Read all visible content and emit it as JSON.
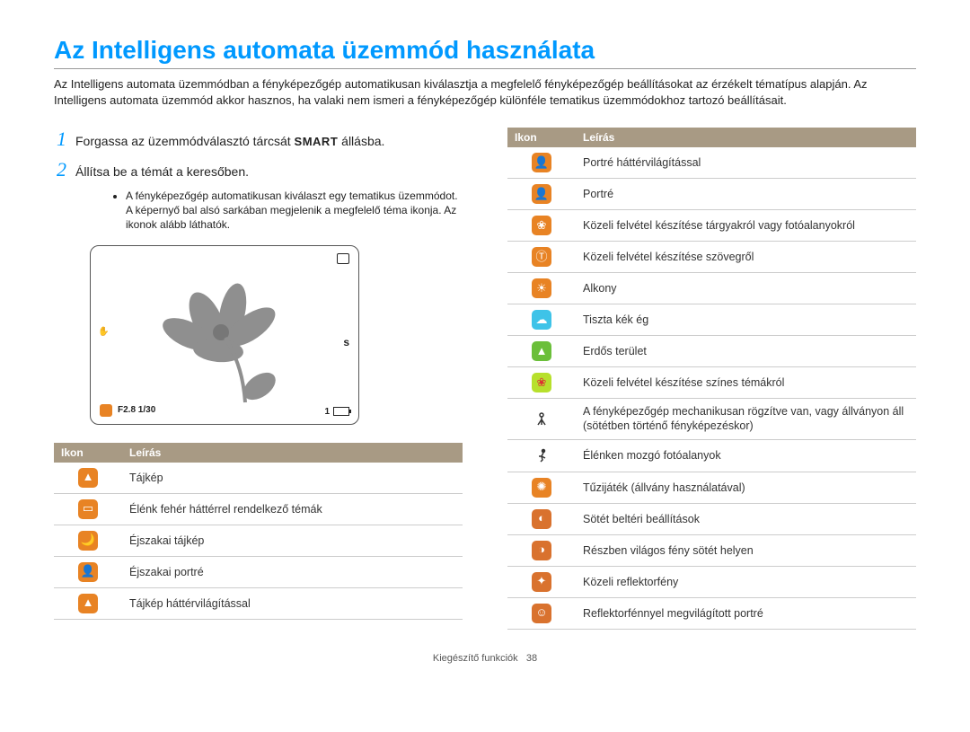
{
  "title": "Az Intelligens automata üzemmód használata",
  "intro": "Az Intelligens automata üzemmódban a fényképezőgép automatikusan kiválasztja a megfelelő fényképezőgép beállításokat az érzékelt tématípus alapján. Az Intelligens automata üzemmód akkor hasznos, ha valaki nem ismeri a fényképezőgép különféle tematikus üzemmódokhoz tartozó beállításait.",
  "steps": {
    "s1": {
      "num": "1",
      "before": "Forgassa az üzemmódválasztó tárcsát ",
      "mode": "SMART",
      "after": " állásba."
    },
    "s2": {
      "num": "2",
      "text": "Állítsa be a témát a keresőben.",
      "bullet": "A fényképezőgép automatikusan kiválaszt egy tematikus üzemmódot. A képernyő bal alsó sarkában megjelenik a megfelelő téma ikonja. Az ikonok alább láthatók."
    }
  },
  "lcd": {
    "exposure": "F2.8  1/30",
    "counter": "1"
  },
  "tableHeaders": {
    "icon": "Ikon",
    "desc": "Leírás"
  },
  "table_left": [
    {
      "glyph": "▲",
      "cls": "orange",
      "name": "landscape-icon",
      "desc": "Tájkép"
    },
    {
      "glyph": "▭",
      "cls": "orange",
      "name": "white-bg-icon",
      "desc": "Élénk fehér háttérrel rendelkező témák"
    },
    {
      "glyph": "🌙",
      "cls": "orange",
      "name": "night-landscape-icon",
      "desc": "Éjszakai tájkép"
    },
    {
      "glyph": "👤",
      "cls": "orange",
      "name": "night-portrait-icon",
      "desc": "Éjszakai portré"
    },
    {
      "glyph": "▲",
      "cls": "orange",
      "name": "backlit-landscape-icon",
      "desc": "Tájkép háttérvilágítással"
    }
  ],
  "table_right": [
    {
      "glyph": "👤",
      "cls": "orange",
      "name": "backlit-portrait-icon",
      "desc": "Portré háttérvilágítással"
    },
    {
      "glyph": "👤",
      "cls": "orange",
      "name": "portrait-icon",
      "desc": "Portré"
    },
    {
      "glyph": "❀",
      "cls": "orange",
      "name": "macro-object-icon",
      "desc": "Közeli felvétel készítése tárgyakról vagy fotóalanyokról"
    },
    {
      "glyph": "Ⓣ",
      "cls": "orange",
      "name": "macro-text-icon",
      "desc": "Közeli felvétel készítése szövegről"
    },
    {
      "glyph": "☀",
      "cls": "orange",
      "name": "sunset-icon",
      "desc": "Alkony"
    },
    {
      "glyph": "☁",
      "cls": "sky",
      "name": "blue-sky-icon",
      "desc": "Tiszta kék ég"
    },
    {
      "glyph": "▲",
      "cls": "green",
      "name": "greenery-icon",
      "desc": "Erdős terület"
    },
    {
      "glyph": "❀",
      "cls": "lime",
      "name": "macro-color-icon",
      "desc": "Közeli felvétel készítése színes témákról"
    },
    {
      "glyph": "tripod",
      "cls": "outline",
      "name": "tripod-icon",
      "desc": "A fényképezőgép mechanikusan rögzítve van, vagy állványon áll (sötétben történő fényképezéskor)"
    },
    {
      "glyph": "run",
      "cls": "outline",
      "name": "action-icon",
      "desc": "Élénken mozgó fotóalanyok"
    },
    {
      "glyph": "✺",
      "cls": "orange",
      "name": "fireworks-icon",
      "desc": "Tűzijáték (állvány használatával)"
    },
    {
      "glyph": "◐",
      "cls": "darkor",
      "name": "dark-indoor-icon",
      "desc": "Sötét beltéri beállítások"
    },
    {
      "glyph": "◑",
      "cls": "darkor",
      "name": "partial-light-icon",
      "desc": "Részben világos fény sötét helyen"
    },
    {
      "glyph": "✦",
      "cls": "darkor",
      "name": "close-spotlight-icon",
      "desc": "Közeli reflektorfény"
    },
    {
      "glyph": "☺",
      "cls": "darkor",
      "name": "spotlight-portrait-icon",
      "desc": "Reflektorfénnyel megvilágított portré"
    }
  ],
  "footer": {
    "section": "Kiegészítő funkciók",
    "page": "38"
  }
}
